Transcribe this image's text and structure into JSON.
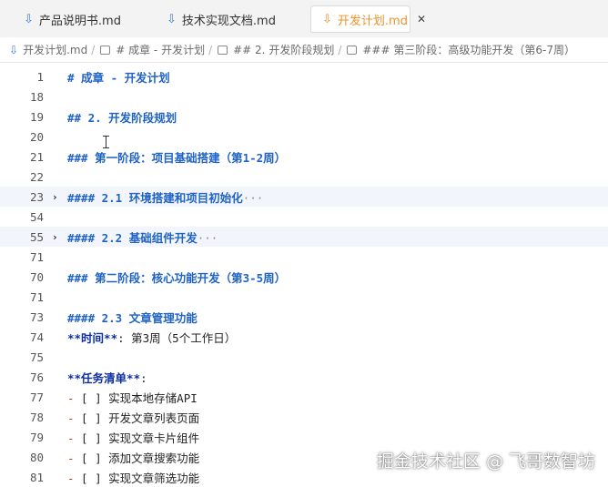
{
  "tabs": [
    {
      "label": "产品说明书.md",
      "active": false
    },
    {
      "label": "技术实现文档.md",
      "active": false
    },
    {
      "label": "开发计划.md",
      "active": true,
      "close_glyph": "✕"
    }
  ],
  "breadcrumb": [
    {
      "label": "开发计划.md",
      "icon": "file-down-icon"
    },
    {
      "label": "# 成章 - 开发计划",
      "icon": "heading-icon"
    },
    {
      "label": "## 2. 开发阶段规划",
      "icon": "heading-icon"
    },
    {
      "label": "### 第三阶段：高级功能开发（第6-7周）",
      "icon": "heading-icon"
    }
  ],
  "breadcrumb_separator": "/",
  "lines": [
    {
      "num": "1",
      "kind": "heading",
      "text": "# 成章 - 开发计划"
    },
    {
      "num": "18",
      "kind": "blank",
      "text": ""
    },
    {
      "num": "19",
      "kind": "heading",
      "text": "## 2. 开发阶段规划"
    },
    {
      "num": "20",
      "kind": "blank",
      "text": ""
    },
    {
      "num": "21",
      "kind": "heading",
      "text": "### 第一阶段：项目基础搭建（第1-2周）"
    },
    {
      "num": "22",
      "kind": "blank",
      "text": ""
    },
    {
      "num": "23",
      "kind": "folded",
      "text": "#### 2.1 环境搭建和项目初始化",
      "ellipsis": "···"
    },
    {
      "num": "54",
      "kind": "blank",
      "text": ""
    },
    {
      "num": "55",
      "kind": "folded",
      "text": "#### 2.2 基础组件开发",
      "ellipsis": "···"
    },
    {
      "num": "71",
      "kind": "blank",
      "text": ""
    },
    {
      "num": "70",
      "kind": "heading",
      "text": "### 第二阶段：核心功能开发（第3-5周）"
    },
    {
      "num": "71",
      "kind": "blank",
      "text": ""
    },
    {
      "num": "73",
      "kind": "heading",
      "text": "#### 2.3 文章管理功能"
    },
    {
      "num": "74",
      "kind": "boldline",
      "bold": "**时间**",
      "rest": ": 第3周（5个工作日）"
    },
    {
      "num": "75",
      "kind": "blank",
      "text": ""
    },
    {
      "num": "76",
      "kind": "boldline",
      "bold": "**任务清单**",
      "rest": ":"
    },
    {
      "num": "77",
      "kind": "task",
      "marker": "-",
      "box": " [ ] ",
      "text": "实现本地存储API"
    },
    {
      "num": "78",
      "kind": "task",
      "marker": "-",
      "box": " [ ] ",
      "text": "开发文章列表页面"
    },
    {
      "num": "79",
      "kind": "task",
      "marker": "-",
      "box": " [ ] ",
      "text": "实现文章卡片组件"
    },
    {
      "num": "80",
      "kind": "task",
      "marker": "-",
      "box": " [ ] ",
      "text": "添加文章搜索功能"
    },
    {
      "num": "81",
      "kind": "task",
      "marker": "-",
      "box": " [ ] ",
      "text": "实现文章筛选功能"
    }
  ],
  "fold_glyph": "›",
  "watermark": "掘金技术社区 @ 飞哥数智坊",
  "colors": {
    "accent": "#f0932b",
    "heading": "#2063c6",
    "bold": "#0d2fa0",
    "marker": "#c0392b",
    "icon": "#3d7bd9"
  }
}
